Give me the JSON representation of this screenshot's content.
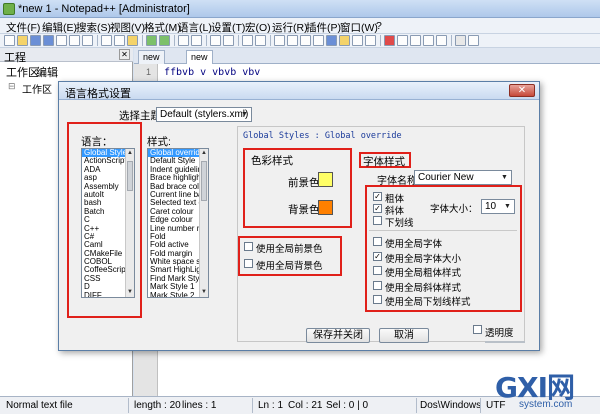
{
  "window": {
    "title": "*new  1 - Notepad++ [Administrator]",
    "menu": [
      "文件(F)",
      "编辑(E)",
      "搜索(S)",
      "视图(V)",
      "格式(M)",
      "语言(L)",
      "设置(T)",
      "宏(O)",
      "运行(R)",
      "插件(P)",
      "窗口(W)",
      "?"
    ]
  },
  "left_panel": {
    "title": "工程",
    "menu": [
      "工作区",
      "编辑"
    ],
    "tree_item": "工作区"
  },
  "editor": {
    "tabs": [
      "new",
      "new"
    ],
    "line_number": "1",
    "code": "ffbvb v  vbvb   vbv"
  },
  "dialog": {
    "title": "语言格式设置",
    "theme_label": "选择主题",
    "theme_value": "Default (stylers.xml)",
    "language_label": "语言：",
    "languages": [
      "Global Styles",
      "ActionScript",
      "ADA",
      "asp",
      "Assembly",
      "autoIt",
      "bash",
      "Batch",
      "C",
      "C++",
      "C#",
      "Caml",
      "CMakeFile",
      "COBOL",
      "CoffeeScript",
      "CSS",
      "D",
      "DIFF"
    ],
    "selected_language": "Global Styles",
    "style_label": "样式:",
    "styles": [
      "Global override",
      "Default Style",
      "Indent guideline sty",
      "Brace highlight styl",
      "Bad brace colour",
      "Current line backgr",
      "Selected text colou",
      "Caret colour",
      "Edge colour",
      "Line number margin",
      "Fold",
      "Fold active",
      "Fold margin",
      "White space symbo",
      "Smart HighLighting",
      "Find Mark Style",
      "Mark Style 1",
      "Mark Style 2"
    ],
    "selected_style": "Global override",
    "header_text": "Global Styles : Global override",
    "color_style": {
      "title": "色彩样式",
      "foreground_label": "前景色",
      "background_label": "背景色",
      "foreground_color": "#ffff66",
      "background_color": "#ff8000"
    },
    "global_color_checks": [
      {
        "label": "使用全局前景色",
        "checked": false
      },
      {
        "label": "使用全局背景色",
        "checked": false
      }
    ],
    "font_style": {
      "title": "字体样式",
      "font_name_label": "字体名称：",
      "font_name_value": "Courier New",
      "bold_label": "粗体",
      "italic_label": "斜体",
      "underline_label": "下划线",
      "bold": true,
      "italic": true,
      "underline": false,
      "size_label": "字体大小：",
      "size_value": "10"
    },
    "global_font_checks": [
      {
        "label": "使用全局字体",
        "checked": false
      },
      {
        "label": "使用全局字体大小",
        "checked": true
      },
      {
        "label": "使用全局粗体样式",
        "checked": false
      },
      {
        "label": "使用全局斜体样式",
        "checked": false
      },
      {
        "label": "使用全局下划线样式",
        "checked": false
      }
    ],
    "save_close_button": "保存并关闭",
    "cancel_button": "取消",
    "transparency_label": "透明度"
  },
  "statusbar": {
    "file_type": "Normal text file",
    "length": "length : 20",
    "lines": "lines : 1",
    "ln": "Ln : 1",
    "col": "Col : 21",
    "sel": "Sel : 0 | 0",
    "eol": "Dos\\Windows",
    "encoding": "UTF"
  },
  "watermark": {
    "logo": "GXI网",
    "site": "system.com"
  },
  "colors": {
    "highlight_red": "#e0201a",
    "selection_blue": "#3399ff"
  }
}
